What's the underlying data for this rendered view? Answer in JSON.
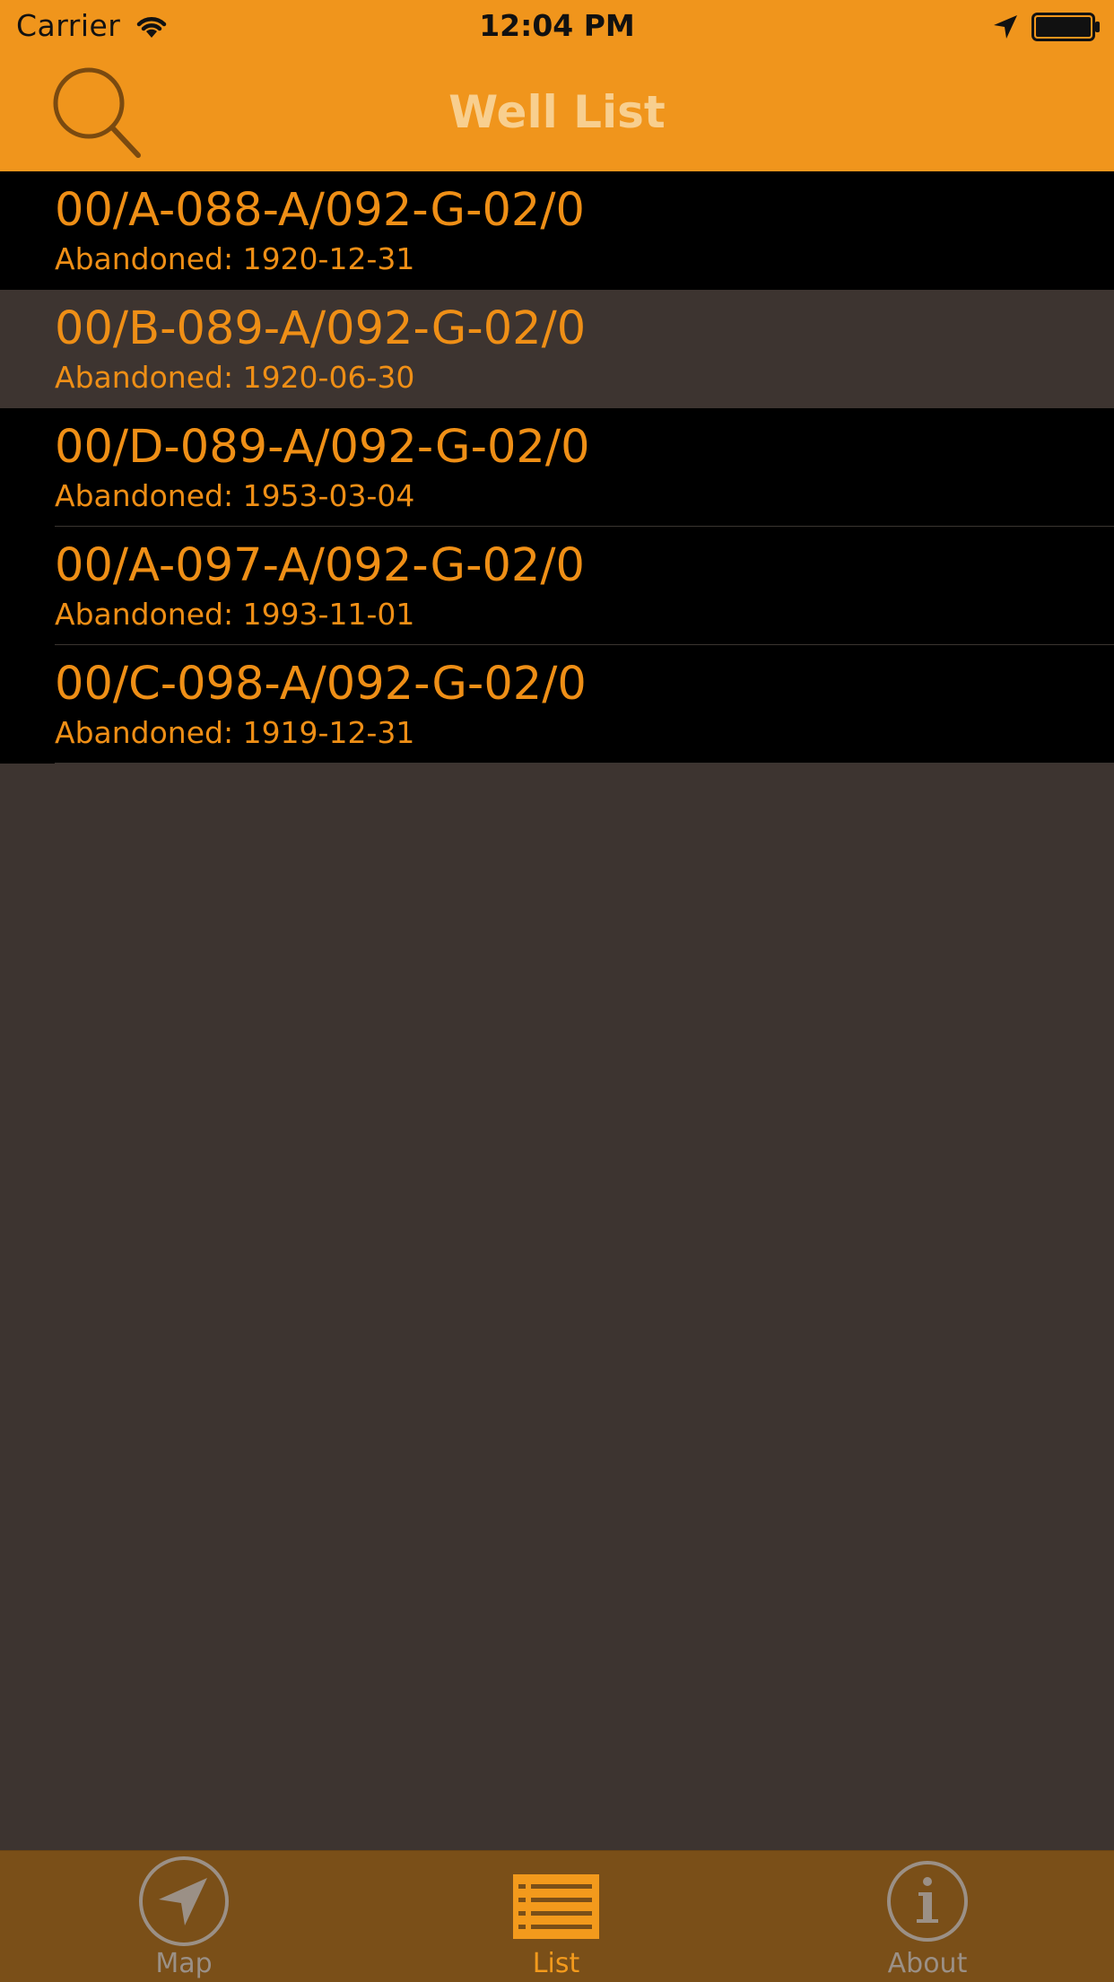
{
  "status_bar": {
    "carrier": "Carrier",
    "time": "12:04 PM",
    "wifi_icon": "wifi-icon",
    "location_icon": "location-arrow-icon",
    "battery_icon": "battery-icon"
  },
  "nav": {
    "title": "Well List",
    "search_icon": "search-icon"
  },
  "wells": [
    {
      "name": "00/A-088-A/092-G-02/0",
      "status": "Abandoned: 1920-12-31",
      "selected": false
    },
    {
      "name": "00/B-089-A/092-G-02/0",
      "status": "Abandoned: 1920-06-30",
      "selected": true
    },
    {
      "name": "00/D-089-A/092-G-02/0",
      "status": "Abandoned: 1953-03-04",
      "selected": false
    },
    {
      "name": "00/A-097-A/092-G-02/0",
      "status": "Abandoned: 1993-11-01",
      "selected": false
    },
    {
      "name": "00/C-098-A/092-G-02/0",
      "status": "Abandoned: 1919-12-31",
      "selected": false
    }
  ],
  "tabs": [
    {
      "label": "Map",
      "icon": "navigation-arrow-icon",
      "active": false
    },
    {
      "label": "List",
      "icon": "list-icon",
      "active": true
    },
    {
      "label": "About",
      "icon": "info-icon",
      "active": false
    }
  ],
  "colors": {
    "accent": "#f0951c",
    "text_orange": "#ef8f16",
    "title_light": "#f8cf8f",
    "background": "#3d3430",
    "row_bg": "#000000",
    "tab_bar_bg": "#7a4f18",
    "tab_inactive": "#9b9086"
  }
}
